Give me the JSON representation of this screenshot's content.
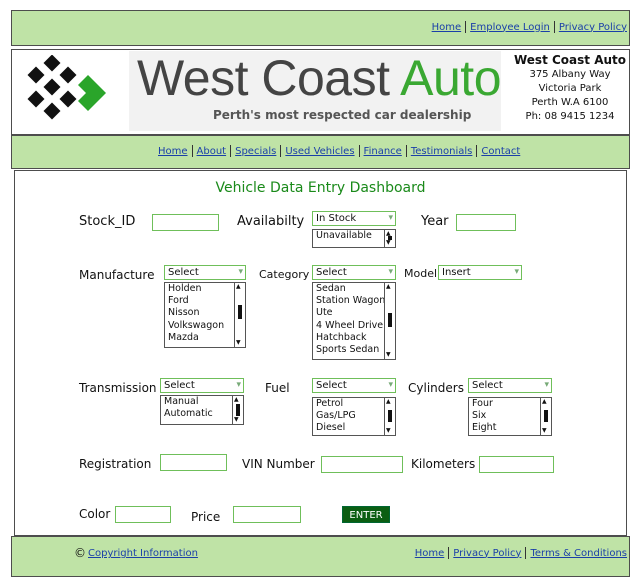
{
  "top_nav": {
    "items": [
      "Home",
      "Employee Login",
      "Privacy Policy"
    ]
  },
  "header": {
    "brand_title": "West Coast Auto",
    "tagline": "Perth's most respected car dealership",
    "address": {
      "name": "West Coast Auto",
      "street": "375 Albany Way",
      "suburb": "Victoria Park",
      "city": "Perth  W.A 6100",
      "phone": "Ph: 08 9415 1234"
    }
  },
  "main_nav": {
    "items": [
      "Home",
      "About",
      "Specials",
      "Used Vehicles",
      "Finance",
      "Testimonials",
      "Contact"
    ]
  },
  "form": {
    "title": "Vehicle Data Entry Dashboard",
    "stock_id_label": "Stock_ID",
    "availability_label": "Availabilty",
    "availability_value": "In Stock",
    "availability_options": [
      "Unavailable"
    ],
    "year_label": "Year",
    "manufacture_label": "Manufacture",
    "manufacture_value": "Select",
    "manufacture_options": [
      "Holden",
      "Ford",
      "Nisson",
      "Volkswagon",
      "Mazda"
    ],
    "category_label": "Category",
    "category_value": "Select",
    "category_options": [
      "Sedan",
      "Station Wagon",
      "Ute",
      "4 Wheel Drive",
      "Hatchback",
      "Sports Sedan"
    ],
    "model_label": "Model",
    "model_value": "Insert",
    "transmission_label": "Transmission",
    "transmission_value": "Select",
    "transmission_options": [
      "Manual",
      "Automatic"
    ],
    "fuel_label": "Fuel",
    "fuel_value": "Select",
    "fuel_options": [
      "Petrol",
      "Gas/LPG",
      "Diesel"
    ],
    "cylinders_label": "Cylinders",
    "cylinders_value": "Select",
    "cylinders_options": [
      "Four",
      "Six",
      "Eight"
    ],
    "registration_label": "Registration",
    "vin_label": "VIN Number",
    "kilometers_label": "Kilometers",
    "color_label": "Color",
    "price_label": "Price",
    "enter_label": "ENTER"
  },
  "footer": {
    "copyright_symbol": "©",
    "copyright_link": "Copyright Information",
    "links": [
      "Home",
      "Privacy Policy",
      "Terms & Conditions"
    ]
  },
  "colors": {
    "band": "#bfe3a6",
    "accent_green": "#1a8a1a",
    "button_bg": "#0b5e12",
    "link": "#1a3fa8",
    "field_border": "#6fbf5a"
  },
  "icons": {
    "logo": "diamond-grid-arrow-icon",
    "copyright": "copyright-icon",
    "scroll_up": "triangle-up-icon",
    "scroll_down": "triangle-down-icon",
    "dropdown": "chevron-down-icon"
  }
}
